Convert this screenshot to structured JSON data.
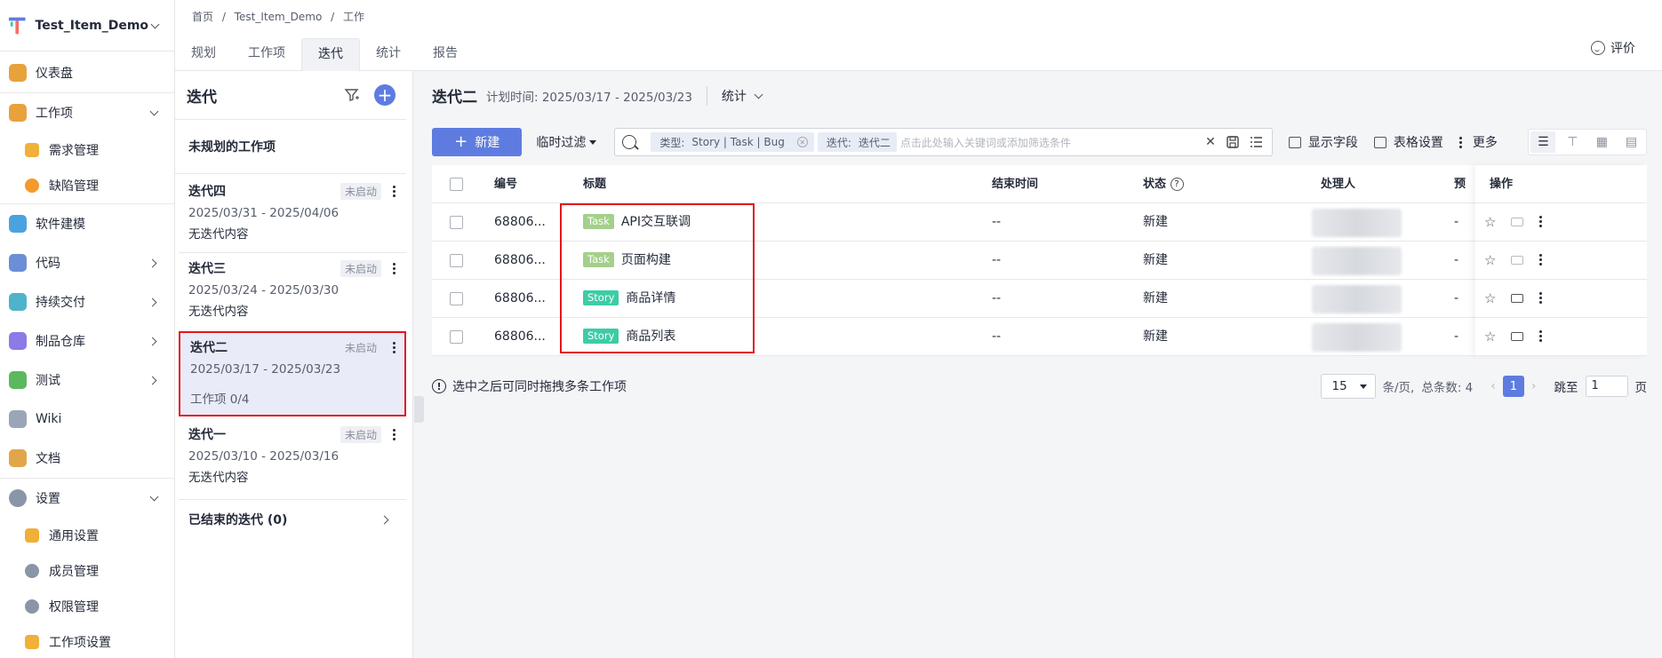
{
  "project": {
    "name": "Test_Item_Demo"
  },
  "sidebar": {
    "items": [
      {
        "label": "仪表盘",
        "icon": "dashboard-icon",
        "color": "#e8a23c"
      },
      {
        "label": "工作项",
        "icon": "workitem-icon",
        "color": "#e8a23c"
      },
      {
        "label": "需求管理",
        "icon": "requirement-icon",
        "color": "#f0b03a"
      },
      {
        "label": "缺陷管理",
        "icon": "bug-icon",
        "color": "#f39a2a"
      },
      {
        "label": "软件建模",
        "icon": "modeling-icon",
        "color": "#4aa3df"
      },
      {
        "label": "代码",
        "icon": "code-icon",
        "color": "#6b8ed6"
      },
      {
        "label": "持续交付",
        "icon": "delivery-icon",
        "color": "#4fb3c9"
      },
      {
        "label": "制品仓库",
        "icon": "artifact-icon",
        "color": "#8c7ae6"
      },
      {
        "label": "测试",
        "icon": "test-icon",
        "color": "#5cb85c"
      },
      {
        "label": "Wiki",
        "icon": "wiki-icon",
        "color": "#9aa6b8"
      },
      {
        "label": "文档",
        "icon": "doc-icon",
        "color": "#e2a64a"
      },
      {
        "label": "设置",
        "icon": "settings-icon",
        "color": "#8a96a8"
      },
      {
        "label": "通用设置",
        "icon": "general-settings-icon",
        "color": "#f0b03a"
      },
      {
        "label": "成员管理",
        "icon": "member-icon",
        "color": "#8a96a8"
      },
      {
        "label": "权限管理",
        "icon": "permission-icon",
        "color": "#8a96a8"
      },
      {
        "label": "工作项设置",
        "icon": "workitem-settings-icon",
        "color": "#f0b03a"
      }
    ]
  },
  "breadcrumb": [
    "首页",
    "/",
    "Test_Item_Demo",
    "/",
    "工作"
  ],
  "tabs": [
    "规划",
    "工作项",
    "迭代",
    "统计",
    "报告"
  ],
  "rate_label": "评价",
  "iter_panel": {
    "title": "迭代",
    "unplanned": "未规划的工作项",
    "iterations": [
      {
        "name": "迭代四",
        "status": "未启动",
        "date": "2025/03/31 - 2025/04/06",
        "desc": "无迭代内容"
      },
      {
        "name": "迭代三",
        "status": "未启动",
        "date": "2025/03/24 - 2025/03/30",
        "desc": "无迭代内容"
      },
      {
        "name": "迭代二",
        "status": "未启动",
        "date": "2025/03/17 - 2025/03/23",
        "desc": "工作项 0/4"
      },
      {
        "name": "迭代一",
        "status": "未启动",
        "date": "2025/03/10 - 2025/03/16",
        "desc": "无迭代内容"
      }
    ],
    "ended": "已结束的迭代 (0)"
  },
  "main": {
    "title": "迭代二",
    "plan_time": "计划时间: 2025/03/17 - 2025/03/23",
    "stat": "统计",
    "new_btn": "新建",
    "temp_filter": "临时过滤",
    "chip1": {
      "key": "类型:",
      "value": "Story | Task | Bug"
    },
    "chip2": {
      "key": "迭代:",
      "value": "迭代二"
    },
    "search_placeholder": "点击此处输入关键词或添加筛选条件",
    "show_fields": "显示字段",
    "table_settings": "表格设置",
    "more": "更多"
  },
  "table": {
    "headers": {
      "id": "编号",
      "title": "标题",
      "end": "结束时间",
      "status": "状态",
      "assignee": "处理人",
      "extra": "预",
      "ops": "操作"
    },
    "rows": [
      {
        "id": "68806...",
        "type": "Task",
        "title": "API交互联调",
        "end": "--",
        "status": "新建",
        "extra": "-"
      },
      {
        "id": "68806...",
        "type": "Task",
        "title": "页面构建",
        "end": "--",
        "status": "新建",
        "extra": "-"
      },
      {
        "id": "68806...",
        "type": "Story",
        "title": "商品详情",
        "end": "--",
        "status": "新建",
        "extra": "-"
      },
      {
        "id": "68806...",
        "type": "Story",
        "title": "商品列表",
        "end": "--",
        "status": "新建",
        "extra": "-"
      }
    ]
  },
  "footer": {
    "hint": "选中之后可同时拖拽多条工作项",
    "page_size": "15",
    "per_page": "条/页,",
    "total": "总条数: 4",
    "current_page": "1",
    "goto": "跳至",
    "goto_value": "1",
    "page_unit": "页"
  }
}
